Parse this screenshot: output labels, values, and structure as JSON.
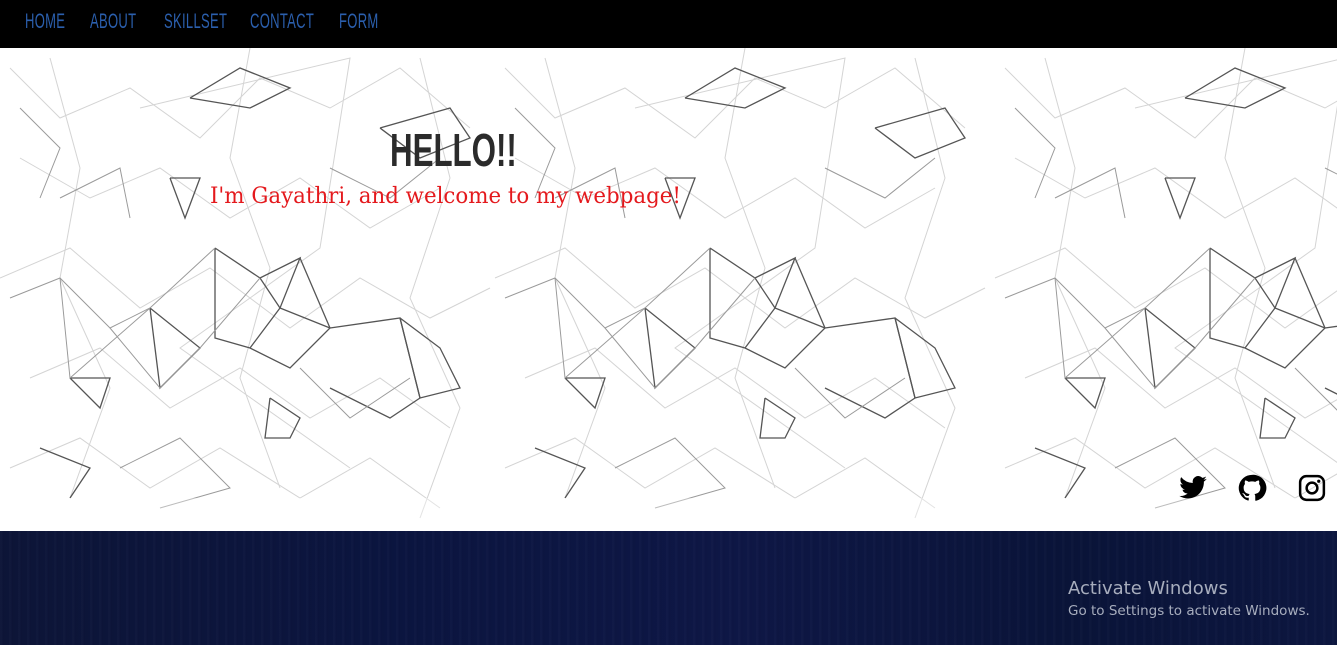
{
  "nav": {
    "items": [
      {
        "label": "HOME"
      },
      {
        "label": "ABOUT"
      },
      {
        "label": "SKILLSET"
      },
      {
        "label": "CONTACT"
      },
      {
        "label": "FORM"
      }
    ]
  },
  "hero": {
    "title": "HELLO!!",
    "subtitle": "I'm Gayathri, and welcome to my webpage!"
  },
  "social": {
    "icons": [
      "twitter-icon",
      "github-icon",
      "instagram-icon"
    ]
  },
  "windows_watermark": {
    "title": "Activate Windows",
    "subtitle": "Go to Settings to activate Windows."
  },
  "colors": {
    "nav_background": "#000000",
    "nav_link": "#2b5fad",
    "subtitle": "#e4191d",
    "footer": "#0b1540"
  }
}
